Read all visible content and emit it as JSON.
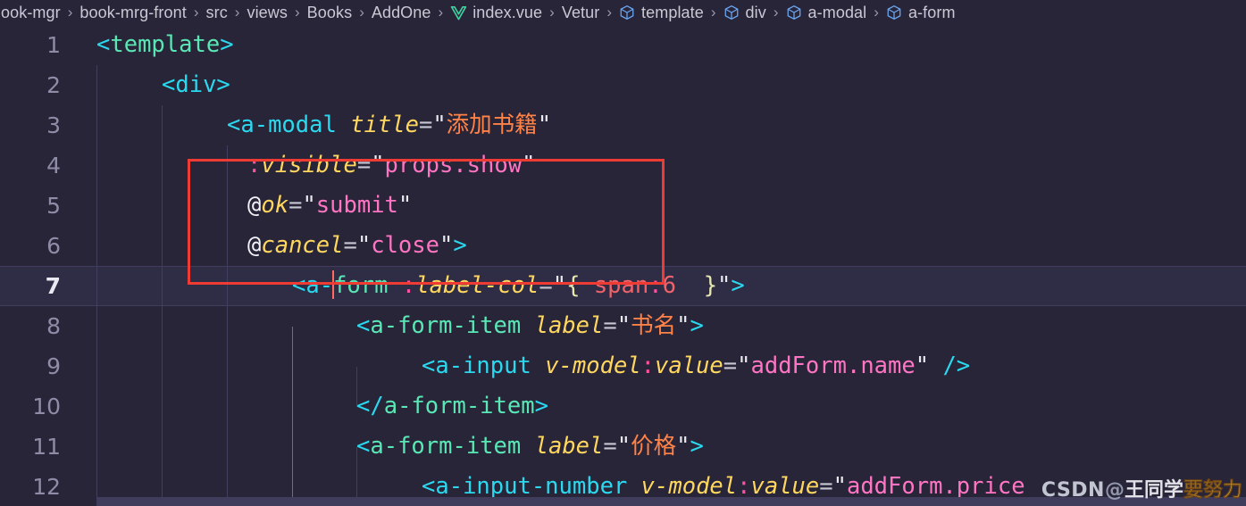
{
  "breadcrumb": {
    "items": [
      {
        "label": "ook-mgr",
        "icon": null
      },
      {
        "label": "book-mrg-front",
        "icon": null
      },
      {
        "label": "src",
        "icon": null
      },
      {
        "label": "views",
        "icon": null
      },
      {
        "label": "Books",
        "icon": null
      },
      {
        "label": "AddOne",
        "icon": null
      },
      {
        "label": "index.vue",
        "icon": "vue-logo-icon"
      },
      {
        "label": "Vetur",
        "icon": null
      },
      {
        "label": "template",
        "icon": "cube-symbol-icon"
      },
      {
        "label": "div",
        "icon": "cube-symbol-icon"
      },
      {
        "label": "a-modal",
        "icon": "cube-symbol-icon"
      },
      {
        "label": "a-form",
        "icon": "cube-symbol-icon"
      }
    ],
    "separator": "›"
  },
  "editor": {
    "active_line": 7,
    "line_numbers": [
      "1",
      "2",
      "3",
      "4",
      "5",
      "6",
      "7",
      "8",
      "9",
      "10",
      "11",
      "12"
    ],
    "lines": [
      {
        "n": "1",
        "indent": 0,
        "text": "<template>"
      },
      {
        "n": "2",
        "indent": 1,
        "text": "<div>"
      },
      {
        "n": "3",
        "indent": 2,
        "text": "<a-modal title=\"添加书籍\""
      },
      {
        "n": "4",
        "indent": 2,
        "text": ":visible=\"props.show\""
      },
      {
        "n": "5",
        "indent": 2,
        "text": "@ok=\"submit\""
      },
      {
        "n": "6",
        "indent": 2,
        "text": "@cancel=\"close\">"
      },
      {
        "n": "7",
        "indent": 3,
        "text": "<a-form :label-col=\"{ span:6  }\">"
      },
      {
        "n": "8",
        "indent": 4,
        "text": "<a-form-item label=\"书名\">"
      },
      {
        "n": "9",
        "indent": 5,
        "text": "<a-input v-model:value=\"addForm.name\" />"
      },
      {
        "n": "10",
        "indent": 4,
        "text": "</a-form-item>"
      },
      {
        "n": "11",
        "indent": 4,
        "text": "<a-form-item label=\"价格\">"
      },
      {
        "n": "12",
        "indent": 5,
        "text": "<a-input-number v-model:value=\"addForm.price\""
      }
    ],
    "tokens": {
      "l1_open": "<",
      "l1_tag": "template",
      "l1_close": ">",
      "l2_open": "<",
      "l2_tag": "div",
      "l2_close": ">",
      "l3_open": "<",
      "l3_tag": "a-modal",
      "l3_attr": "title",
      "l3_eq": "=",
      "l3_q1": "\"",
      "l3_val": "添加书籍",
      "l3_q2": "\"",
      "l4_colon": ":",
      "l4_attr": "visible",
      "l4_eq": "=",
      "l4_q1": "\"",
      "l4_val": "props.show",
      "l4_q2": "\"",
      "l5_at": "@",
      "l5_attr": "ok",
      "l5_eq": "=",
      "l5_q1": "\"",
      "l5_val": "submit",
      "l5_q2": "\"",
      "l6_at": "@",
      "l6_attr": "cancel",
      "l6_eq": "=",
      "l6_q1": "\"",
      "l6_val": "close",
      "l6_q2": "\"",
      "l6_close": ">",
      "l7_open": "<",
      "l7_tag_a": "a-",
      "l7_tag_b": "form",
      "l7_colon": ":",
      "l7_attr": "label-col",
      "l7_eq": "=",
      "l7_q1": "\"",
      "l7_brace_open": "{",
      "l7_key": "span",
      "l7_keycolon": ":",
      "l7_num": "6",
      "l7_brace_close": "}",
      "l7_q2": "\"",
      "l7_close": ">",
      "l8_open": "<",
      "l8_tag": "a-form-item",
      "l8_attr": "label",
      "l8_eq": "=",
      "l8_q1": "\"",
      "l8_val": "书名",
      "l8_q2": "\"",
      "l8_close": ">",
      "l9_open": "<",
      "l9_tag": "a-input",
      "l9_attr": "v-model",
      "l9_colon": ":",
      "l9_attr2": "value",
      "l9_eq": "=",
      "l9_q1": "\"",
      "l9_val": "addForm.name",
      "l9_q2": "\"",
      "l9_selfclose": "/>",
      "l10_open": "</",
      "l10_tag": "a-form-item",
      "l10_close": ">",
      "l11_open": "<",
      "l11_tag": "a-form-item",
      "l11_attr": "label",
      "l11_eq": "=",
      "l11_q1": "\"",
      "l11_val": "价格",
      "l11_q2": "\"",
      "l11_close": ">",
      "l12_open": "<",
      "l12_tag": "a-input-number",
      "l12_attr": "v-model",
      "l12_colon": ":",
      "l12_attr2": "value",
      "l12_eq": "=",
      "l12_q1": "\"",
      "l12_val": "addForm.price"
    }
  },
  "annotation": {
    "box_color": "#ee3b33",
    "covers_lines": "4-6"
  },
  "watermark": {
    "site": "CSDN",
    "at": "@",
    "author": "王同学",
    "suffix": "要努力"
  },
  "colors": {
    "editor_background": "#282539",
    "active_line_background": "#2f2c45",
    "tag_green": "#59e8b5",
    "punct_cyan": "#2bd9ef",
    "attr_yellow": "#ffd75f",
    "string_pink": "#ff75c3",
    "string_orange": "#ff8247",
    "number_red": "#f0636a",
    "line_number": "#8e8ca6",
    "indent_guide": "#413e5e",
    "indent_guide_active": "#7a5ea8"
  }
}
